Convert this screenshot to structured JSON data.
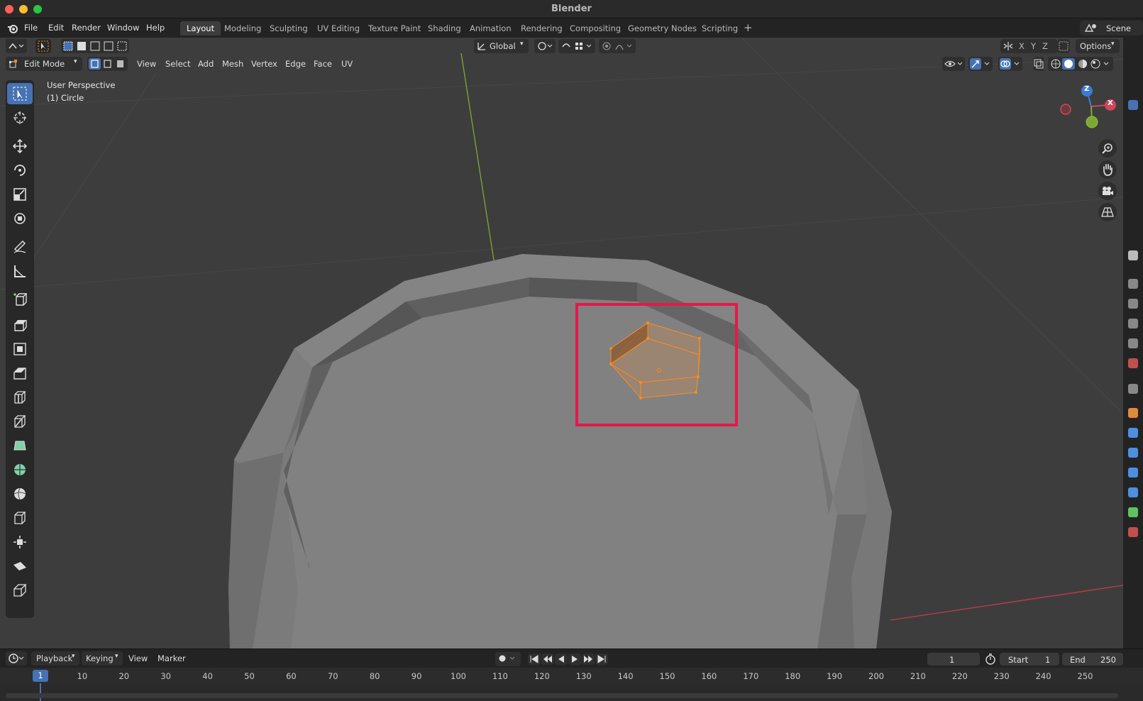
{
  "window": {
    "title": "Blender"
  },
  "menu": [
    "File",
    "Edit",
    "Render",
    "Window",
    "Help"
  ],
  "workspaces": [
    "Layout",
    "Modeling",
    "Sculpting",
    "UV Editing",
    "Texture Paint",
    "Shading",
    "Animation",
    "Rendering",
    "Compositing",
    "Geometry Nodes",
    "Scripting"
  ],
  "active_workspace": "Layout",
  "scene": {
    "label": "Scene"
  },
  "viewport_header": {
    "transform_orientation": "Global",
    "options_label": "Options",
    "axis_x": "X",
    "axis_y": "Y",
    "axis_z": "Z"
  },
  "edit_header": {
    "mode": "Edit Mode",
    "menus": [
      "View",
      "Select",
      "Add",
      "Mesh",
      "Vertex",
      "Edge",
      "Face",
      "UV"
    ]
  },
  "viewport_overlay": {
    "perspective": "User Perspective",
    "object": "(1) Circle"
  },
  "gizmo": {
    "x": "X",
    "z": "Z"
  },
  "timeline": {
    "menus": [
      "Playback",
      "Keying",
      "View",
      "Marker"
    ],
    "current_frame": "1",
    "start_label": "Start",
    "start_value": "1",
    "end_label": "End",
    "end_value": "250",
    "ruler_current": "1",
    "ruler_ticks": [
      "10",
      "20",
      "30",
      "40",
      "50",
      "60",
      "70",
      "80",
      "90",
      "100",
      "110",
      "120",
      "130",
      "140",
      "150",
      "160",
      "170",
      "180",
      "190",
      "200",
      "210",
      "220",
      "230",
      "240",
      "250"
    ]
  },
  "colors": {
    "accent": "#4772b3",
    "selection_orange": "#ff8c1a",
    "highlight_box": "#e8174a",
    "mesh": "#7d7d7d",
    "axis_y": "#7fa833",
    "axis_x": "#c43b4e"
  }
}
